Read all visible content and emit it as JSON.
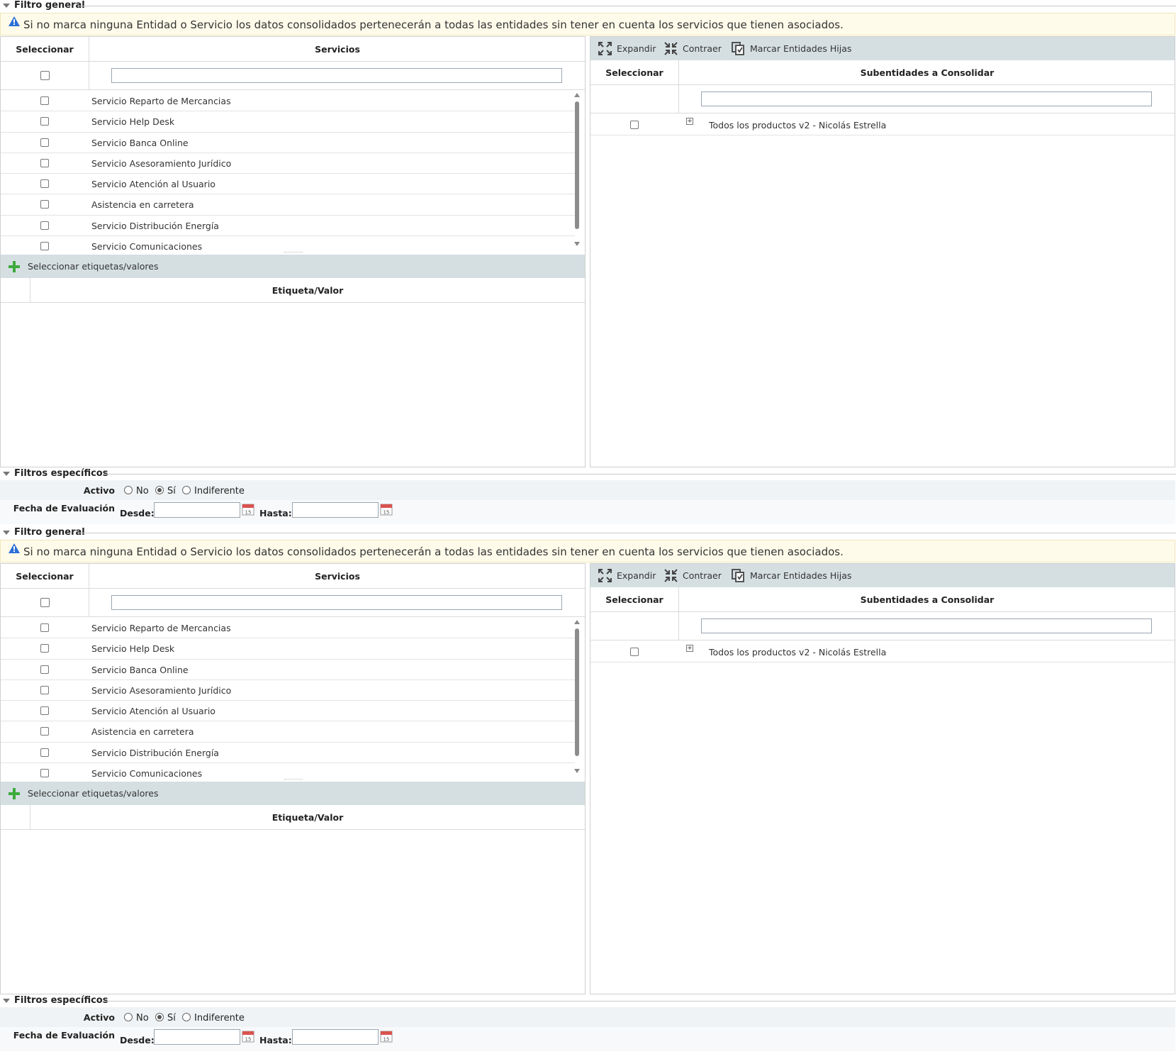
{
  "filtro_general": {
    "legend": "Filtro general",
    "info_text": "Si no marca ninguna Entidad o Servicio los datos consolidados pertenecerán a todas las entidades sin tener en cuenta los servicios que tienen asociados."
  },
  "servicios_table": {
    "col_select": "Seleccionar",
    "col_name": "Servicios",
    "rows": [
      "Servicio Reparto de Mercancias",
      "Servicio Help Desk",
      "Servicio Banca Online",
      "Servicio Asesoramiento Jurídico",
      "Servicio Atención al Usuario",
      "Asistencia en carretera",
      "Servicio Distribución Energía",
      "Servicio Comunicaciones"
    ]
  },
  "etiquetas": {
    "add_label": "Seleccionar etiquetas/valores",
    "col_name": "Etiqueta/Valor"
  },
  "subentidades": {
    "toolbar": {
      "expand": "Expandir",
      "collapse": "Contraer",
      "mark_children": "Marcar Entidades Hijas"
    },
    "col_select": "Seleccionar",
    "col_name": "Subentidades a Consolidar",
    "rows": [
      "Todos los productos v2 - Nicolás Estrella"
    ]
  },
  "filtros_especificos": {
    "legend": "Filtros específicos",
    "activo_label": "Activo",
    "activo_options": [
      "No",
      "Sí",
      "Indiferente"
    ],
    "activo_selected": "Sí",
    "fecha_label": "Fecha de Evaluación",
    "desde_label": "Desde:",
    "hasta_label": "Hasta:",
    "desde_value": "",
    "hasta_value": "",
    "calendar_day": "15"
  },
  "colors": {
    "toolbar_bg": "#d5dfe2",
    "info_bg": "#fffbea",
    "add_icon": "#3daa3d",
    "calendar_icon": "#d9534f",
    "warning_icon": "#2a6fd6"
  },
  "icons": [
    "warning-icon",
    "plus-icon",
    "expand-icon",
    "collapse-icon",
    "mark-children-icon",
    "tree-expand-icon",
    "calendar-icon",
    "collapse-triangle-icon"
  ]
}
